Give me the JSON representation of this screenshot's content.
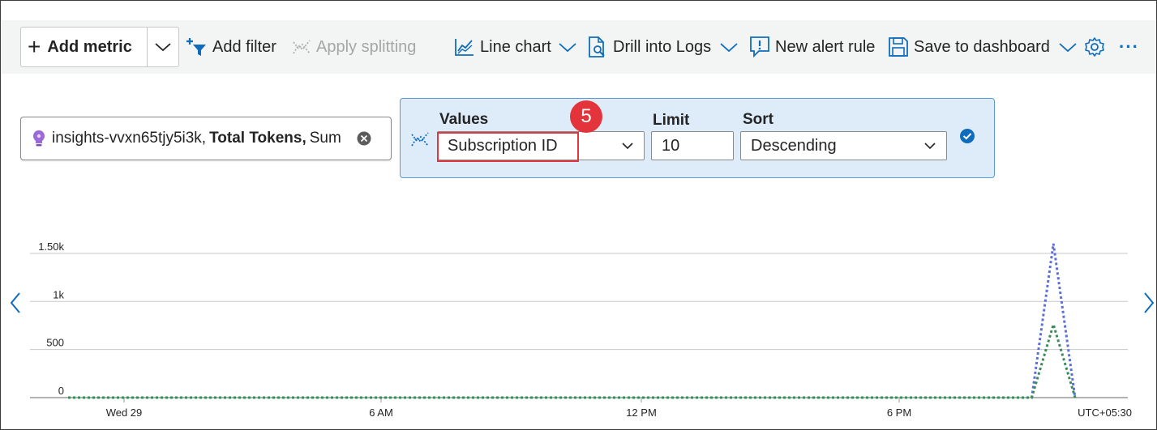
{
  "toolbar": {
    "add_metric": "Add metric",
    "add_filter": "Add filter",
    "apply_splitting": "Apply splitting",
    "line_chart": "Line chart",
    "drill_into_logs": "Drill into Logs",
    "new_alert_rule": "New alert rule",
    "save_to_dashboard": "Save to dashboard",
    "more": "···"
  },
  "metric_pill": {
    "resource": "insights-vvxn65tjy5i3k,",
    "metric": "Total Tokens,",
    "aggregation": "Sum"
  },
  "splitting": {
    "values_label": "Values",
    "values_selected": "Subscription ID",
    "limit_label": "Limit",
    "limit_value": "10",
    "sort_label": "Sort",
    "sort_selected": "Descending",
    "step_badge": "5"
  },
  "colors": {
    "accent": "#0f6cbd",
    "highlight": "#e0373e",
    "panel_bg": "#deecf9",
    "series_blue": "#5b6fd6",
    "series_green": "#3a8a5a"
  },
  "chart_data": {
    "type": "line",
    "y_tick_labels": [
      "1.50k",
      "1k",
      "500",
      "0"
    ],
    "y_ticks": [
      1500,
      1000,
      500,
      0
    ],
    "ylim": [
      0,
      1600
    ],
    "x_tick_labels": [
      "Wed 29",
      "6 AM",
      "12 PM",
      "6 PM"
    ],
    "timezone_label": "UTC+05:30",
    "series": [
      {
        "values": [
          0,
          0,
          0,
          0,
          0,
          1600,
          0
        ]
      },
      {
        "values": [
          0,
          0,
          0,
          0,
          0,
          760,
          0
        ]
      }
    ],
    "x": [
      "00:00",
      "06:00",
      "12:00",
      "18:00",
      "21:00",
      "21:30",
      "22:00"
    ]
  }
}
